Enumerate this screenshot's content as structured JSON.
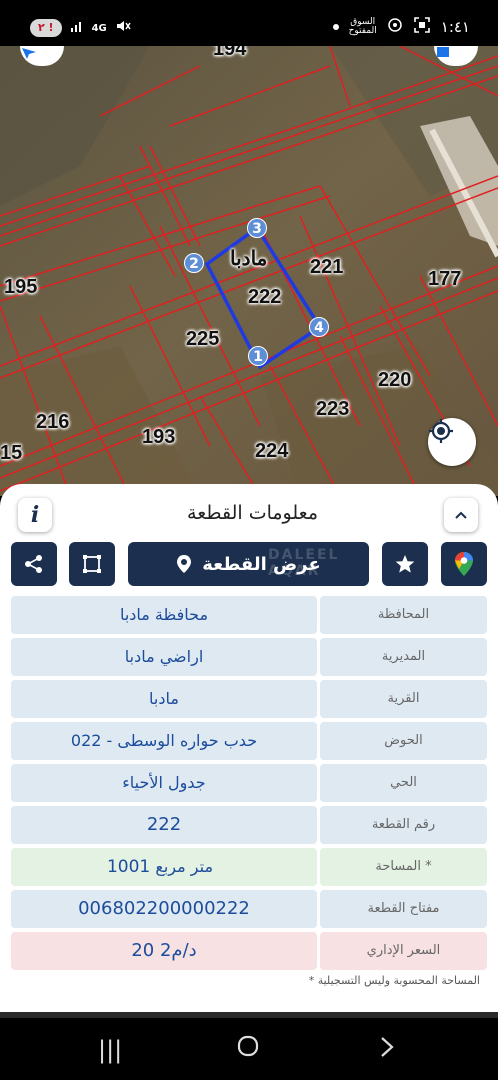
{
  "status_bar": {
    "time": "١:٤١",
    "badge": "٢ !",
    "network": "4G",
    "icons": [
      "alarm-icon",
      "wifi-icon",
      "signal-icon",
      "mute-icon",
      "battery-icon",
      "app-icon",
      "screenshot-icon",
      "dot"
    ]
  },
  "map": {
    "parcel_numbers": {
      "p194": "194",
      "p195": "195",
      "p221": "221",
      "p177": "177",
      "p222": "222",
      "p225": "225",
      "p220": "220",
      "p216": "216",
      "p193": "193",
      "p223": "223",
      "p224": "224",
      "p15": "15"
    },
    "village_label": "مادبا",
    "vertices": [
      "1",
      "2",
      "3",
      "4"
    ],
    "colors": {
      "ground": "#6a5e48",
      "parcel_lines": "#e02020",
      "selected": "#1f3ae0"
    }
  },
  "sheet": {
    "title": "معلومات القطعة",
    "info_icon": "i",
    "show_parcel_label": "عرض القطعة",
    "watermark": "DALEEL AQAR",
    "rows": [
      {
        "label": "المحافظة",
        "value": "محافظة مادبا"
      },
      {
        "label": "المديرية",
        "value": "اراضي مادبا"
      },
      {
        "label": "القرية",
        "value": "مادبا"
      },
      {
        "label": "الحوض",
        "value": "حدب حواره الوسطى - 022"
      },
      {
        "label": "الحي",
        "value": "جدول الأحياء"
      },
      {
        "label": "رقم القطعة",
        "value": "222"
      },
      {
        "label": "المساحة *",
        "value_num": "1001",
        "value_unit": "متر مربع"
      },
      {
        "label": "مفتاح القطعة",
        "value": "006802200000222"
      },
      {
        "label": "السعر الإداري",
        "value": "20 د/م2"
      }
    ],
    "footnote": "* المساحة المحسوبة وليس التسجيلية",
    "colors": {
      "primary": "#1c2f4e",
      "value_text": "#1c4c9c",
      "row_bg": "#dfe9f2",
      "area_bg": "#e3f2e3",
      "price_bg": "#f8e1e3"
    }
  },
  "nav_bar": {
    "recent": "|||",
    "home": "○",
    "back": "‹"
  }
}
